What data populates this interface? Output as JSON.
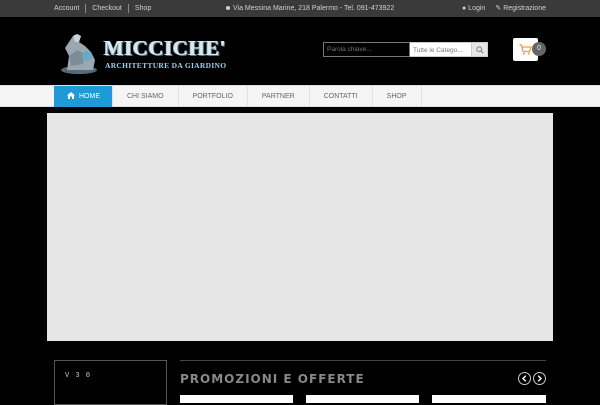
{
  "topbar": {
    "links": [
      "Account",
      "Checkout",
      "Shop"
    ],
    "address": "Via Messina Marine, 218 Palermo - Tel. 091-473922",
    "login": "Login",
    "register": "Registrazione"
  },
  "logo": {
    "brand": "MICCICHE'",
    "tagline": "ARCHITETTURE DA GIARDINO"
  },
  "search": {
    "placeholder": "Parola chiave...",
    "category": "Tutte le Catego..."
  },
  "cart": {
    "count": "0"
  },
  "nav": {
    "items": [
      "HOME",
      "CHI SIAMO",
      "PORTFOLIO",
      "PARTNER",
      "CONTATTI",
      "SHOP"
    ]
  },
  "sidebox": {
    "title": "V 3 0"
  },
  "promo": {
    "title": "PROMOZIONI E OFFERTE"
  },
  "colors": {
    "accent": "#1e9ad6",
    "cart_icon": "#f0a030",
    "topbar_bg": "#3a3a3a"
  }
}
